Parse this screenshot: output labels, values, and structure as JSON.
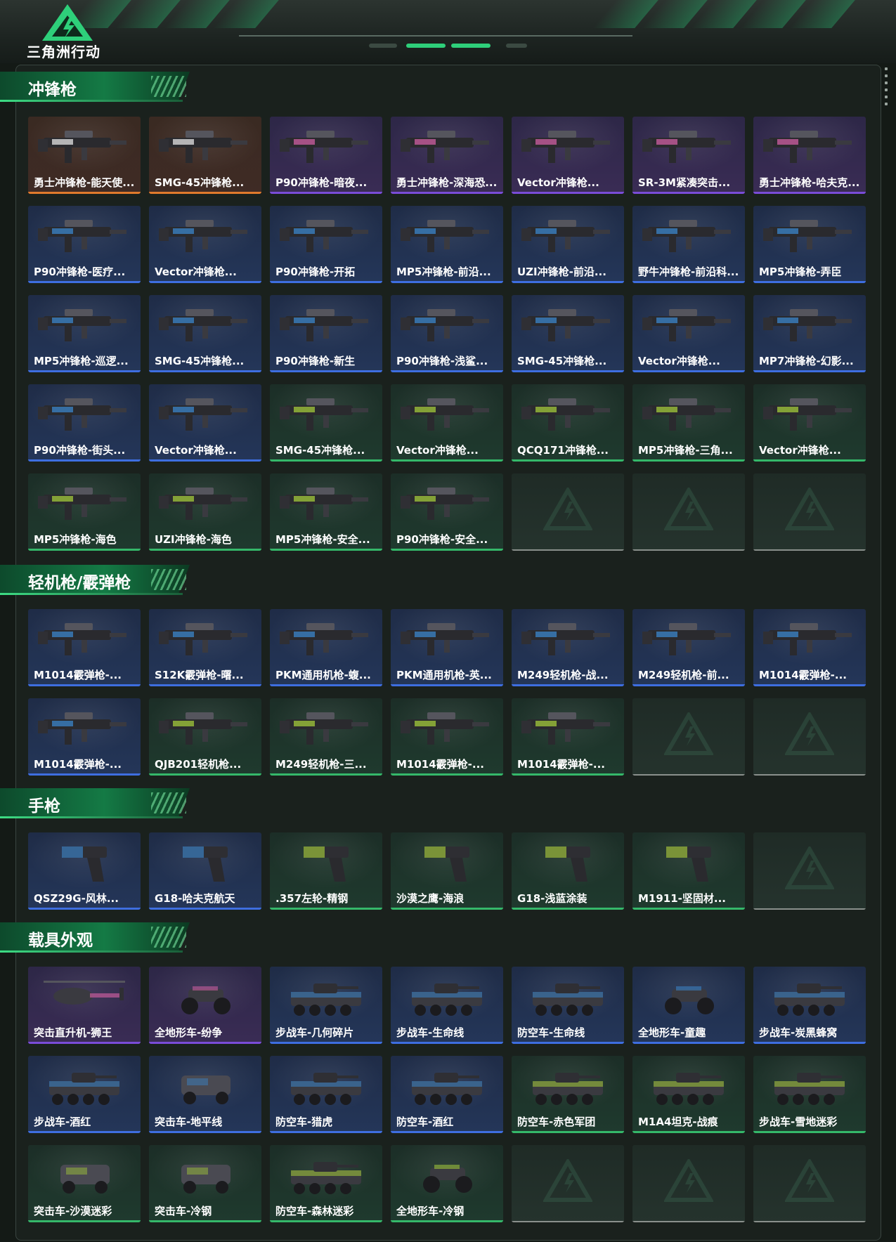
{
  "header": {
    "logo_text": "三角洲行动"
  },
  "sections": [
    {
      "title": "冲锋枪",
      "items": [
        {
          "label": "勇士冲锋枪-能天使...",
          "rarity": "orange",
          "kind": "gun"
        },
        {
          "label": "SMG-45冲锋枪...",
          "rarity": "orange",
          "kind": "gun"
        },
        {
          "label": "P90冲锋枪-暗夜...",
          "rarity": "purple",
          "kind": "gun"
        },
        {
          "label": "勇士冲锋枪-深海恐...",
          "rarity": "purple",
          "kind": "gun"
        },
        {
          "label": "Vector冲锋枪...",
          "rarity": "purple",
          "kind": "gun"
        },
        {
          "label": "SR-3M紧凑突击...",
          "rarity": "purple",
          "kind": "gun"
        },
        {
          "label": "勇士冲锋枪-哈夫克...",
          "rarity": "purple",
          "kind": "gun"
        },
        {
          "label": "P90冲锋枪-医疗...",
          "rarity": "blue",
          "kind": "gun"
        },
        {
          "label": "Vector冲锋枪...",
          "rarity": "blue",
          "kind": "gun"
        },
        {
          "label": "P90冲锋枪-开拓",
          "rarity": "blue",
          "kind": "gun"
        },
        {
          "label": "MP5冲锋枪-前沿...",
          "rarity": "blue",
          "kind": "gun"
        },
        {
          "label": "UZI冲锋枪-前沿...",
          "rarity": "blue",
          "kind": "gun"
        },
        {
          "label": "野牛冲锋枪-前沿科...",
          "rarity": "blue",
          "kind": "gun"
        },
        {
          "label": "MP5冲锋枪-弄臣",
          "rarity": "blue",
          "kind": "gun"
        },
        {
          "label": "MP5冲锋枪-巡逻...",
          "rarity": "blue",
          "kind": "gun"
        },
        {
          "label": "SMG-45冲锋枪...",
          "rarity": "blue",
          "kind": "gun"
        },
        {
          "label": "P90冲锋枪-新生",
          "rarity": "blue",
          "kind": "gun"
        },
        {
          "label": "P90冲锋枪-浅鲨...",
          "rarity": "blue",
          "kind": "gun"
        },
        {
          "label": "SMG-45冲锋枪...",
          "rarity": "blue",
          "kind": "gun"
        },
        {
          "label": "Vector冲锋枪...",
          "rarity": "blue",
          "kind": "gun"
        },
        {
          "label": "MP7冲锋枪-幻影...",
          "rarity": "blue",
          "kind": "gun"
        },
        {
          "label": "P90冲锋枪-街头...",
          "rarity": "blue",
          "kind": "gun"
        },
        {
          "label": "Vector冲锋枪...",
          "rarity": "blue",
          "kind": "gun"
        },
        {
          "label": "SMG-45冲锋枪...",
          "rarity": "green",
          "kind": "gun"
        },
        {
          "label": "Vector冲锋枪...",
          "rarity": "green",
          "kind": "gun"
        },
        {
          "label": "QCQ171冲锋枪...",
          "rarity": "green",
          "kind": "gun"
        },
        {
          "label": "MP5冲锋枪-三角...",
          "rarity": "green",
          "kind": "gun"
        },
        {
          "label": "Vector冲锋枪...",
          "rarity": "green",
          "kind": "gun"
        },
        {
          "label": "MP5冲锋枪-海色",
          "rarity": "green",
          "kind": "gun"
        },
        {
          "label": "UZI冲锋枪-海色",
          "rarity": "green",
          "kind": "gun"
        },
        {
          "label": "MP5冲锋枪-安全...",
          "rarity": "green",
          "kind": "gun"
        },
        {
          "label": "P90冲锋枪-安全...",
          "rarity": "green",
          "kind": "gun"
        }
      ],
      "empty_slots": 3
    },
    {
      "title": "轻机枪/霰弹枪",
      "items": [
        {
          "label": "M1014霰弹枪-...",
          "rarity": "blue",
          "kind": "gun"
        },
        {
          "label": "S12K霰弹枪-曙...",
          "rarity": "blue",
          "kind": "gun"
        },
        {
          "label": "PKM通用机枪-蝮...",
          "rarity": "blue",
          "kind": "gun"
        },
        {
          "label": "PKM通用机枪-英...",
          "rarity": "blue",
          "kind": "gun"
        },
        {
          "label": "M249轻机枪-战...",
          "rarity": "blue",
          "kind": "gun"
        },
        {
          "label": "M249轻机枪-前...",
          "rarity": "blue",
          "kind": "gun"
        },
        {
          "label": "M1014霰弹枪-...",
          "rarity": "blue",
          "kind": "gun"
        },
        {
          "label": "M1014霰弹枪-...",
          "rarity": "blue",
          "kind": "gun"
        },
        {
          "label": "QJB201轻机枪...",
          "rarity": "green",
          "kind": "gun"
        },
        {
          "label": "M249轻机枪-三...",
          "rarity": "green",
          "kind": "gun"
        },
        {
          "label": "M1014霰弹枪-...",
          "rarity": "green",
          "kind": "gun"
        },
        {
          "label": "M1014霰弹枪-...",
          "rarity": "green",
          "kind": "gun"
        }
      ],
      "empty_slots": 2
    },
    {
      "title": "手枪",
      "items": [
        {
          "label": "QSZ29G-风林...",
          "rarity": "blue",
          "kind": "pistol"
        },
        {
          "label": "G18-哈夫克航天",
          "rarity": "blue",
          "kind": "pistol"
        },
        {
          "label": ".357左轮-精钢",
          "rarity": "green",
          "kind": "pistol"
        },
        {
          "label": "沙漠之鹰-海浪",
          "rarity": "green",
          "kind": "pistol"
        },
        {
          "label": "G18-浅蓝涂装",
          "rarity": "green",
          "kind": "pistol"
        },
        {
          "label": "M1911-坚固材...",
          "rarity": "green",
          "kind": "pistol"
        }
      ],
      "empty_slots": 1
    },
    {
      "title": "载具外观",
      "items": [
        {
          "label": "突击直升机-狮王",
          "rarity": "purple",
          "kind": "heli"
        },
        {
          "label": "全地形车-纷争",
          "rarity": "purple",
          "kind": "atv"
        },
        {
          "label": "步战车-几何碎片",
          "rarity": "blue",
          "kind": "tank"
        },
        {
          "label": "步战车-生命线",
          "rarity": "blue",
          "kind": "tank"
        },
        {
          "label": "防空车-生命线",
          "rarity": "blue",
          "kind": "tank"
        },
        {
          "label": "全地形车-童趣",
          "rarity": "blue",
          "kind": "atv"
        },
        {
          "label": "步战车-炭黑蜂窝",
          "rarity": "blue",
          "kind": "tank"
        },
        {
          "label": "步战车-酒红",
          "rarity": "blue",
          "kind": "tank"
        },
        {
          "label": "突击车-地平线",
          "rarity": "blue",
          "kind": "car"
        },
        {
          "label": "防空车-猎虎",
          "rarity": "blue",
          "kind": "tank"
        },
        {
          "label": "防空车-酒红",
          "rarity": "blue",
          "kind": "tank"
        },
        {
          "label": "防空车-赤色军团",
          "rarity": "green",
          "kind": "tank"
        },
        {
          "label": "M1A4坦克-战痕",
          "rarity": "green",
          "kind": "tank"
        },
        {
          "label": "步战车-雪地迷彩",
          "rarity": "green",
          "kind": "tank"
        },
        {
          "label": "突击车-沙漠迷彩",
          "rarity": "green",
          "kind": "car"
        },
        {
          "label": "突击车-冷钢",
          "rarity": "green",
          "kind": "car"
        },
        {
          "label": "防空车-森林迷彩",
          "rarity": "green",
          "kind": "tank"
        },
        {
          "label": "全地形车-冷钢",
          "rarity": "green",
          "kind": "atv"
        }
      ],
      "empty_slots": 3
    }
  ],
  "colors": {
    "purple": "#7a4cd8",
    "blue": "#3e6ee0",
    "green": "#35b86a",
    "orange": "#e07a2c",
    "accent": "#3ddc84"
  }
}
